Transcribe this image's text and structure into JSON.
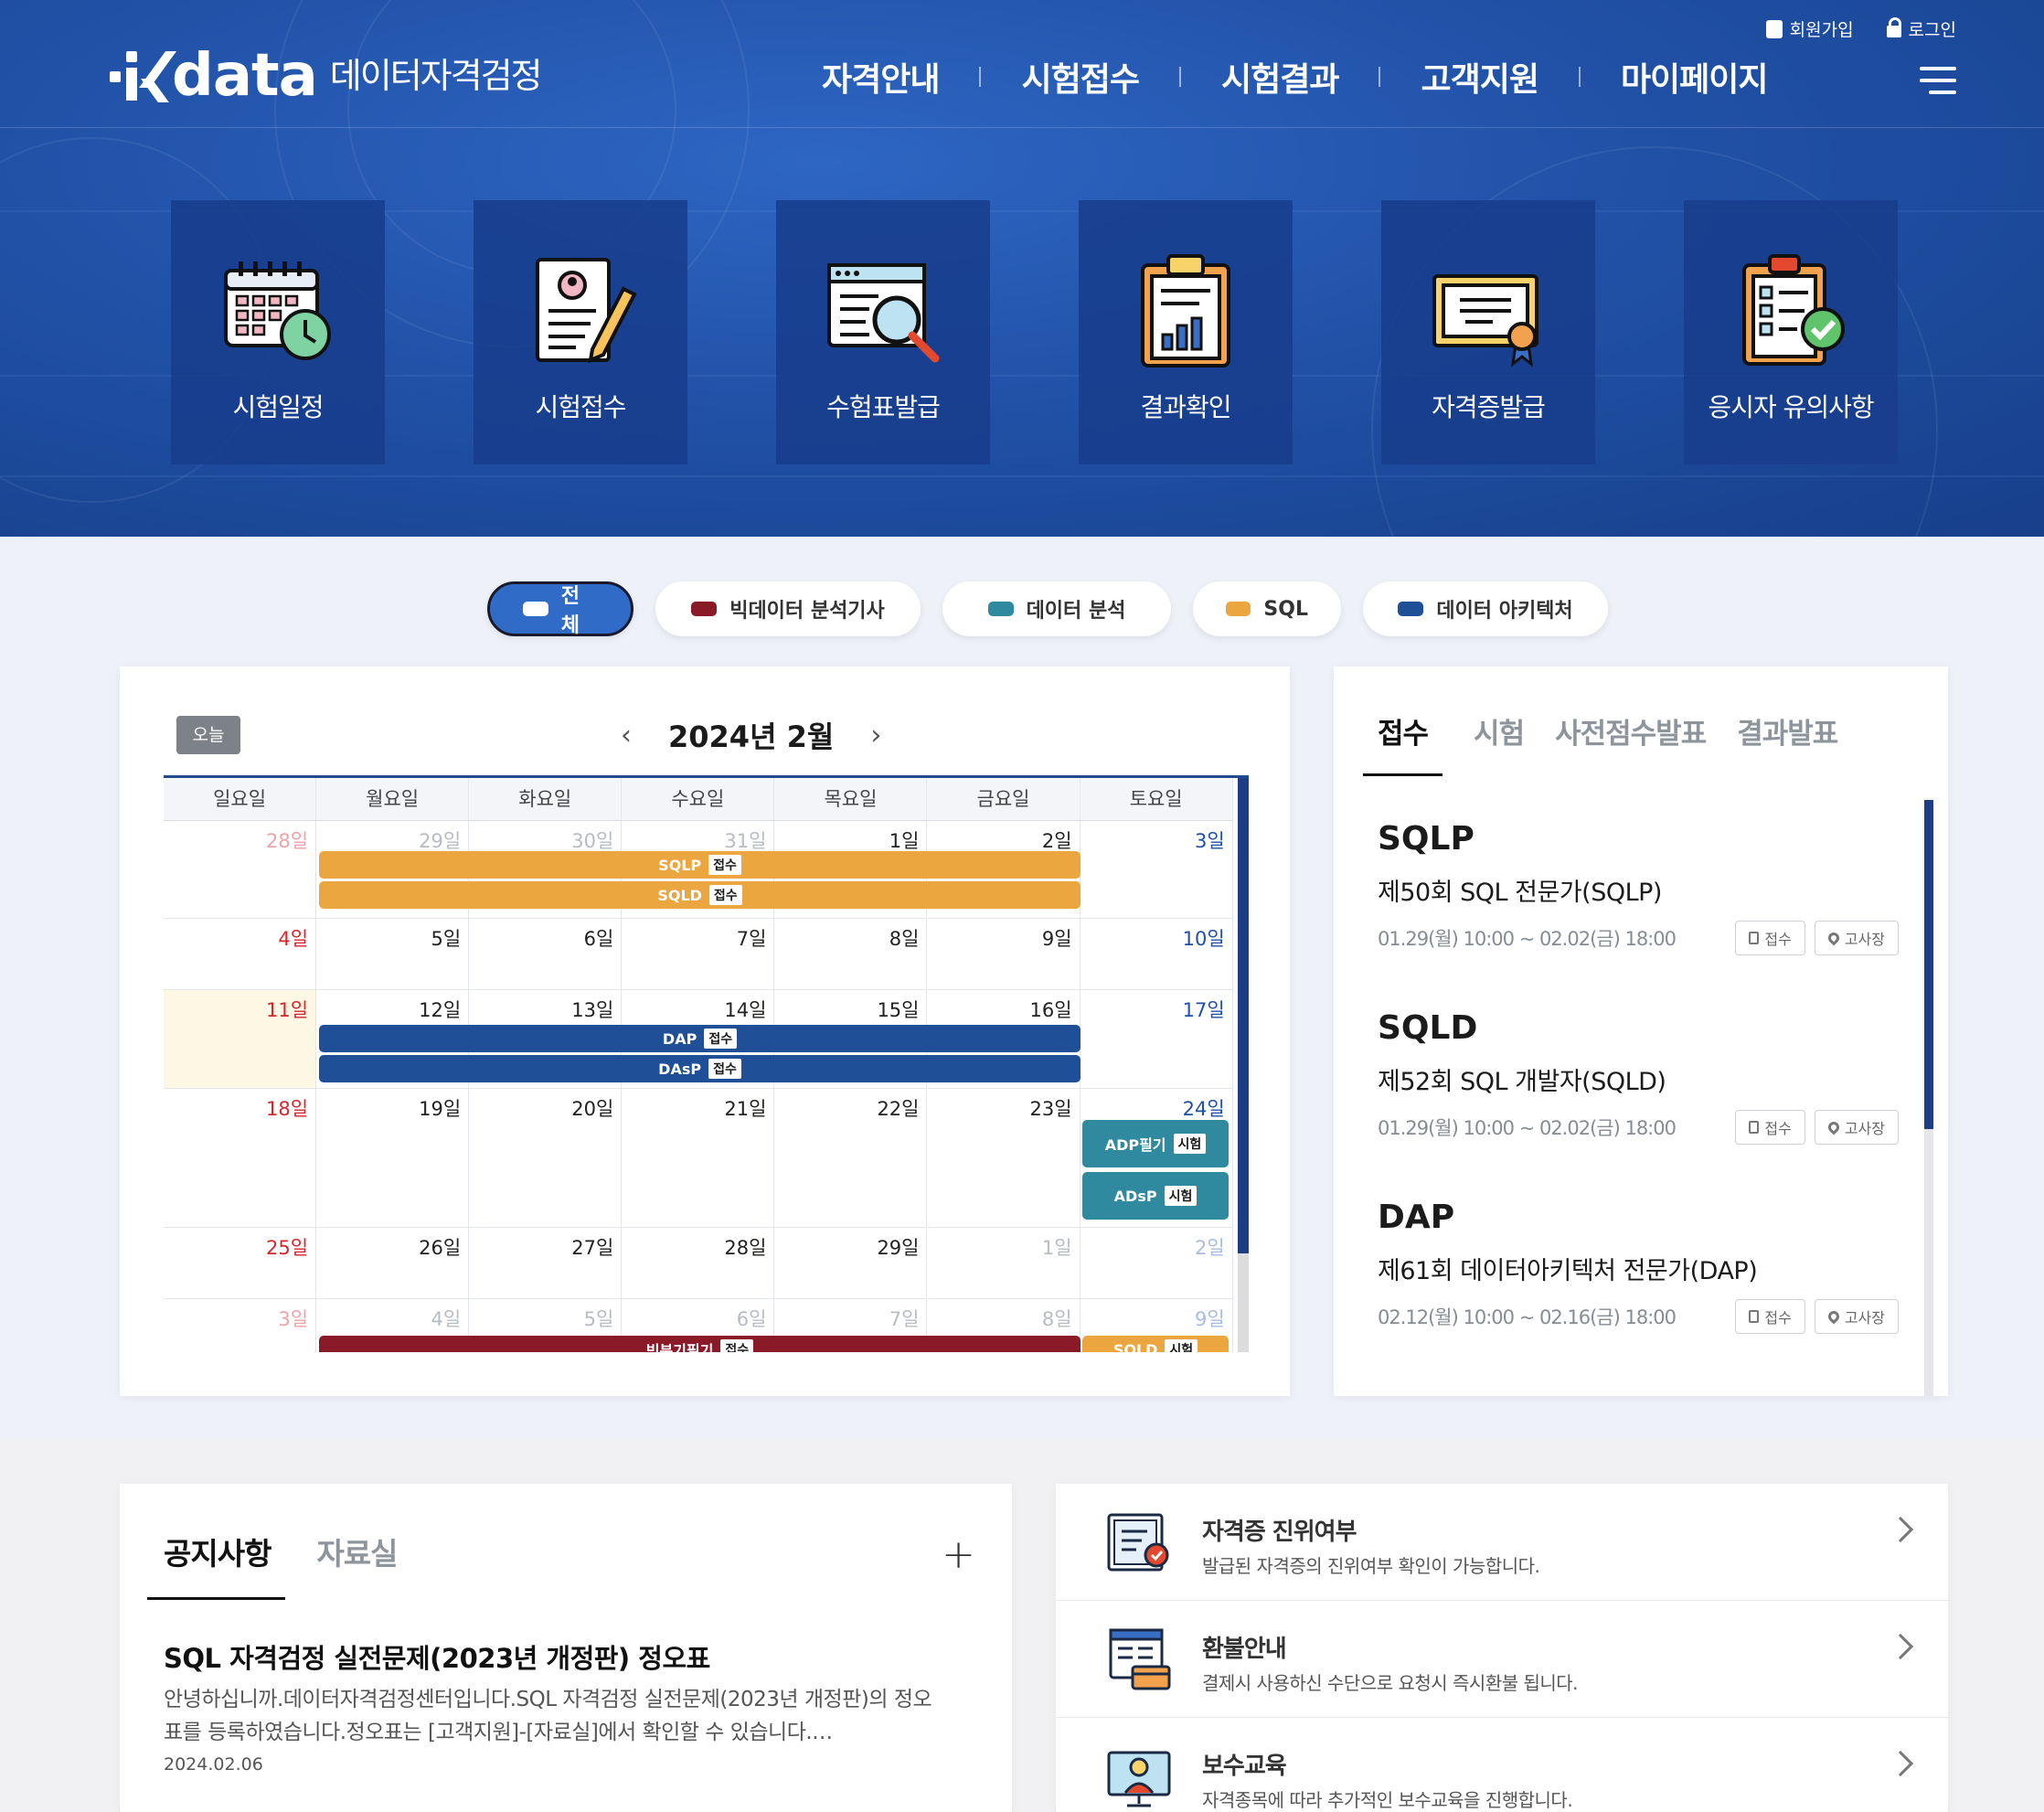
{
  "header": {
    "logo_word": "data",
    "logo_sub": "데이터자격검정",
    "util": {
      "signup": "회원가입",
      "login": "로그인"
    },
    "nav": [
      "자격안내",
      "시험접수",
      "시험결과",
      "고객지원",
      "마이페이지"
    ]
  },
  "tiles": [
    {
      "label": "시험일정",
      "icon": "calendar-clock-icon"
    },
    {
      "label": "시험접수",
      "icon": "document-pen-icon"
    },
    {
      "label": "수험표발급",
      "icon": "browser-search-icon"
    },
    {
      "label": "결과확인",
      "icon": "clipboard-chart-icon"
    },
    {
      "label": "자격증발급",
      "icon": "certificate-icon"
    },
    {
      "label": "응시자 유의사항",
      "icon": "checklist-icon"
    }
  ],
  "filters": [
    {
      "label": "전체",
      "color": "#ffffff",
      "active": true
    },
    {
      "label": "빅데이터 분석기사",
      "color": "#8a1a27"
    },
    {
      "label": "데이터 분석",
      "color": "#2f8aa0"
    },
    {
      "label": "SQL",
      "color": "#eca63f"
    },
    {
      "label": "데이터 아키텍처",
      "color": "#1f4f97"
    }
  ],
  "calendar": {
    "today_label": "오늘",
    "title": "2024년 2월",
    "weekdays": [
      "일요일",
      "월요일",
      "화요일",
      "수요일",
      "목요일",
      "금요일",
      "토요일"
    ],
    "weeks": [
      [
        "28일",
        "29일",
        "30일",
        "31일",
        "1일",
        "2일",
        "3일"
      ],
      [
        "4일",
        "5일",
        "6일",
        "7일",
        "8일",
        "9일",
        "10일"
      ],
      [
        "11일",
        "12일",
        "13일",
        "14일",
        "15일",
        "16일",
        "17일"
      ],
      [
        "18일",
        "19일",
        "20일",
        "21일",
        "22일",
        "23일",
        "24일"
      ],
      [
        "25일",
        "26일",
        "27일",
        "28일",
        "29일",
        "1일",
        "2일"
      ],
      [
        "3일",
        "4일",
        "5일",
        "6일",
        "7일",
        "8일",
        "9일"
      ]
    ],
    "events": {
      "sqlp": {
        "name": "SQLP",
        "tag": "접수"
      },
      "sqld": {
        "name": "SQLD",
        "tag": "접수"
      },
      "dap": {
        "name": "DAP",
        "tag": "접수"
      },
      "dasp": {
        "name": "DAsP",
        "tag": "접수"
      },
      "adp": {
        "name": "ADP필기",
        "tag": "시험"
      },
      "adsp": {
        "name": "ADsP",
        "tag": "시험"
      },
      "big": {
        "name": "빅분기필기",
        "tag": "접수"
      },
      "sat9": {
        "name": "SQLD",
        "tag": "시험"
      }
    }
  },
  "schedule": {
    "tabs": [
      "접수",
      "시험",
      "사전점수발표",
      "결과발표"
    ],
    "items": [
      {
        "code": "SQLP",
        "name": "제50회 SQL 전문가(SQLP)",
        "date": "01.29(월) 10:00 ~ 02.02(금) 18:00"
      },
      {
        "code": "SQLD",
        "name": "제52회 SQL 개발자(SQLD)",
        "date": "01.29(월) 10:00 ~ 02.02(금) 18:00"
      },
      {
        "code": "DAP",
        "name": "제61회 데이터아키텍처 전문가(DAP)",
        "date": "02.12(월) 10:00 ~ 02.16(금) 18:00"
      }
    ],
    "btn_apply": "접수",
    "btn_site": "고사장"
  },
  "notice": {
    "tabs": [
      "공지사항",
      "자료실"
    ],
    "title": "SQL 자격검정 실전문제(2023년 개정판) 정오표",
    "body": "안녕하십니까.데이터자격검정센터입니다.SQL 자격검정 실전문제(2023년 개정판)의 정오표를 등록하였습니다.정오표는 [고객지원]-[자료실]에서 확인할 수 있습니다.…",
    "date": "2024.02.06",
    "more": "+"
  },
  "links": [
    {
      "title": "자격증 진위여부",
      "desc": "발급된 자격증의 진위여부 확인이 가능합니다.",
      "icon": "certificate-verify-icon"
    },
    {
      "title": "환불안내",
      "desc": "결제시 사용하신 수단으로 요청시 즉시환불 됩니다.",
      "icon": "refund-card-icon"
    },
    {
      "title": "보수교육",
      "desc": "자격종목에 따라 추가적인 보수교육을 진행합니다.",
      "icon": "education-monitor-icon"
    }
  ]
}
